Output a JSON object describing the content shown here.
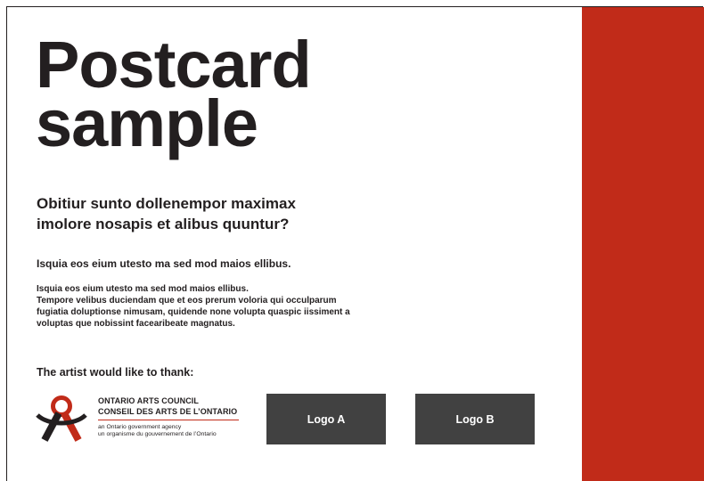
{
  "title": {
    "line1": "Postcard",
    "line2": "sample"
  },
  "subtitle": {
    "line1": "Obitiur sunto dollenempor maximax",
    "line2": "imolore nosapis et alibus quuntur?"
  },
  "lead": "Isquia eos eium utesto ma sed mod maios ellibus.",
  "body": {
    "line1": "Isquia eos eium utesto ma sed mod maios ellibus.",
    "line2": "Tempore velibus duciendam que et eos prerum voloria qui occulparum",
    "line3": "fugiatia doluptionse nimusam, quidende none volupta quaspic iissiment a",
    "line4": "voluptas que nobissint facearibeate magnatus."
  },
  "thanks": "The artist would like to thank:",
  "sponsor": {
    "name_en": "ONTARIO ARTS COUNCIL",
    "name_fr": "CONSEIL DES ARTS DE L’ONTARIO",
    "agency_en": "an Ontario government agency",
    "agency_fr": "un organisme du gouvernement de l’Ontario",
    "icon": "oac-logo-icon"
  },
  "logos": {
    "a": "Logo A",
    "b": "Logo B"
  },
  "colors": {
    "accent_red": "#c12b19",
    "logo_box": "#414141",
    "text": "#231f20"
  }
}
